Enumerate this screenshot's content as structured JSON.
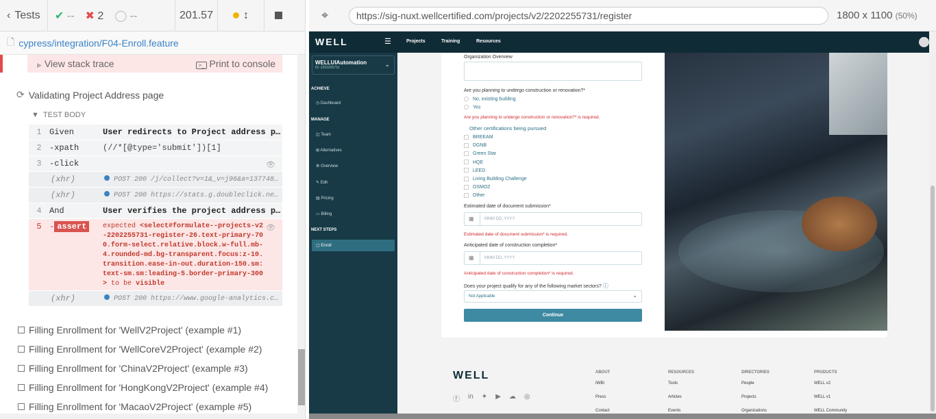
{
  "runner": {
    "tests_label": "Tests",
    "passed": "--",
    "failed": "2",
    "pending": "--",
    "duration": "201.57",
    "spec_path": "cypress/integration/F04-Enroll.feature"
  },
  "error": {
    "stack_trace": "View stack trace",
    "print": "Print to console"
  },
  "test": {
    "title": "Validating Project Address page",
    "body_label": "TEST BODY",
    "commands": [
      {
        "num": "1",
        "name": "Given",
        "msg": "User redirects to Project address page"
      },
      {
        "num": "",
        "name": "-xpath",
        "msg": "(//*[@type='submit'])[1]"
      },
      {
        "num": "3",
        "name": "-click",
        "msg": ""
      },
      {
        "name": "(xhr)",
        "msg": "POST 200 /j/collect?v=1&_v=j96&a=13774812..."
      },
      {
        "name": "(xhr)",
        "msg": "POST 200 https://stats.g.doubleclick.net/..."
      },
      {
        "num": "4",
        "name": "And",
        "msg": "User verifies the project address pag..."
      },
      {
        "num": "5",
        "name": "-assert",
        "msg": "expected <select#formulate--projects-v2-2202255731-register-26.text-primary-700.form-select.relative.block.w-full.mb-4.rounded-md.bg-transparent.focus:z-10.transition.ease-in-out.duration-150.sm:text-sm.sm:leading-5.border-primary-300> to be visible"
      },
      {
        "name": "(xhr)",
        "msg": "POST 200 https://www.google-analytics.com..."
      }
    ],
    "fail_tag": "assert",
    "fail_expected": "expected",
    "fail_el": "<select#formulate--projects-v2-2202255731-register-26.text-primary-700.form-select.relative.block.w-full.mb-4.rounded-md.bg-transparent.focus:z-10.transition.ease-in-out.duration-150.sm:text-sm.sm:leading-5.border-primary-300>",
    "fail_tobe": "to be",
    "fail_vis": "visible"
  },
  "examples": [
    "Filling Enrollment for 'WellV2Project' (example #1)",
    "Filling Enrollment for 'WellCoreV2Project' (example #2)",
    "Filling Enrollment for 'ChinaV2Project' (example #3)",
    "Filling Enrollment for 'HongKongV2Project' (example #4)",
    "Filling Enrollment for 'MacaoV2Project' (example #5)"
  ],
  "browser": {
    "url": "https://sig-nuxt.wellcertified.com/projects/v2/2202255731/register",
    "size": "1800 x 1100",
    "zoom": "(50%)"
  },
  "app": {
    "logo": "WELL",
    "nav": [
      "Projects",
      "Training",
      "Resources"
    ],
    "project": "WELLUIAutomation",
    "project_id": "ID: 2202255731",
    "sections": [
      {
        "title": "ACHIEVE",
        "items": [
          "Dashboard"
        ]
      },
      {
        "title": "MANAGE",
        "items": [
          "Team",
          "Alternatives",
          "Overview",
          "Edit",
          "Pricing",
          "Billing"
        ]
      },
      {
        "title": "NEXT STEPS",
        "items": [
          "Enroll"
        ]
      }
    ],
    "form": {
      "org_overview": "Organization Overview",
      "construction_q": "Are you planning to undergo construction or renovation?*",
      "opt_no": "No, existing building",
      "opt_yes": "Yes",
      "construction_err": "Are you planning to undergo construction or renovation?* is required.",
      "other_certs": "Other certifications being pursued",
      "certs": [
        "BREEAM",
        "DGNB",
        "Green Star",
        "HQE",
        "LEED",
        "Living Building Challenge",
        "OSMOZ",
        "Other"
      ],
      "doc_date": "Estimated date of document submission*",
      "doc_placeholder": "MMM DD, YYYY",
      "doc_err": "Estimated date of document submission* is required.",
      "cons_date": "Anticipated date of construction completion*",
      "cons_placeholder": "MMM DD, YYYY",
      "cons_err": "Anticipated date of construction completion* is required.",
      "sector_q": "Does your project qualify for any of the following market sectors?",
      "sector_val": "Not Applicable",
      "continue": "Continue"
    },
    "footer": {
      "logo": "WELL",
      "cols": [
        {
          "h": "ABOUT",
          "items": [
            "IWBI",
            "Press",
            "Contact"
          ]
        },
        {
          "h": "RESOURCES",
          "items": [
            "Tools",
            "Articles",
            "Events"
          ]
        },
        {
          "h": "DIRECTORIES",
          "items": [
            "People",
            "Projects",
            "Organizations"
          ]
        },
        {
          "h": "PRODUCTS",
          "items": [
            "WELL v2",
            "WELL v1",
            "WELL Community"
          ]
        }
      ]
    }
  }
}
